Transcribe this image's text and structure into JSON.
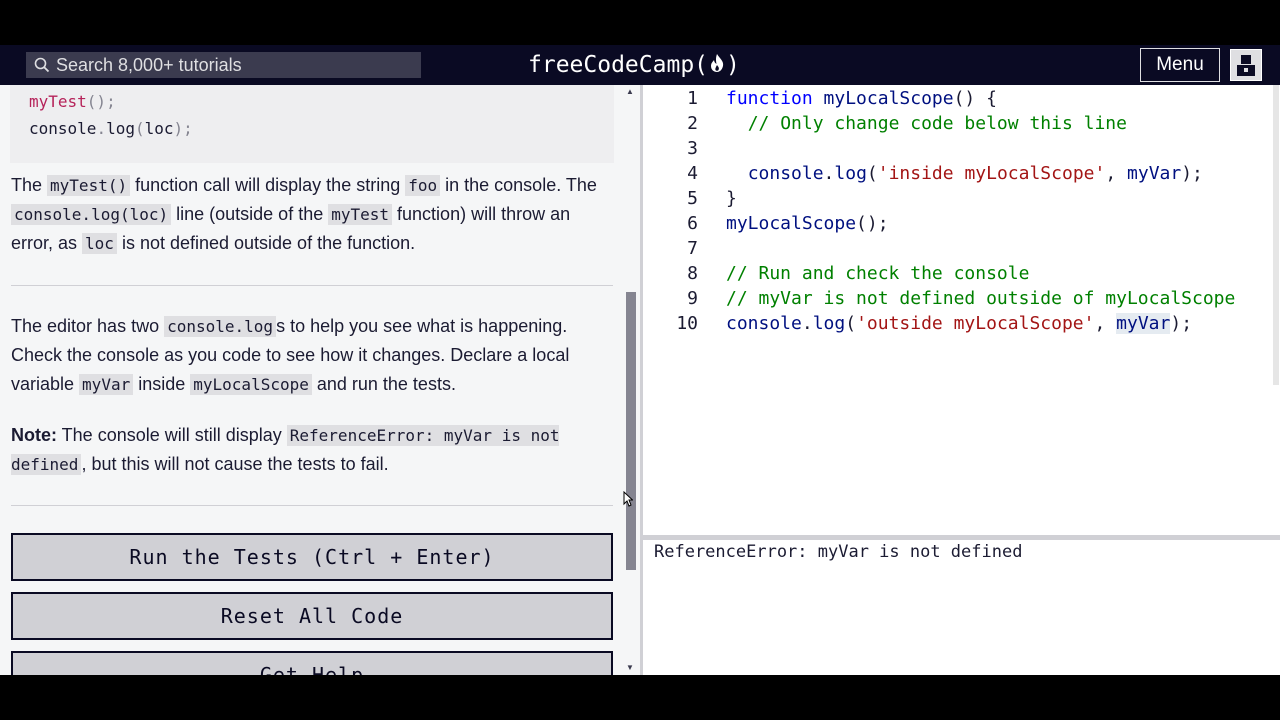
{
  "navbar": {
    "search_placeholder": "Search 8,000+ tutorials",
    "brand_text": "freeCodeCamp(",
    "brand_close": ")",
    "menu_label": "Menu",
    "icons": {
      "search": "search-icon",
      "flame": "flame-icon",
      "avatar": "avatar-icon"
    }
  },
  "instructions": {
    "code_example": {
      "line1": {
        "fn": "myTest",
        "punc": "();"
      },
      "line2": {
        "obj": "console",
        "dot": ".",
        "method": "log",
        "open": "(",
        "arg": "loc",
        "close": ");"
      }
    },
    "para1": {
      "t1": "The ",
      "c1": "myTest()",
      "t2": " function call will display the string ",
      "c2": "foo",
      "t3": " in the console. The ",
      "c3": "console.log(loc)",
      "t4": " line (outside of the ",
      "c4": "myTest",
      "t5": " function) will throw an error, as ",
      "c5": "loc",
      "t6": " is not defined outside of the function."
    },
    "para2": {
      "t1": "The editor has two ",
      "c1": "console.log",
      "t2": "s to help you see what is happening. Check the console as you code to see how it changes. Declare a local variable ",
      "c2": "myVar",
      "t3": " inside ",
      "c3": "myLocalScope",
      "t4": " and run the tests."
    },
    "para3": {
      "bold": "Note:",
      "t1": " The console will still display ",
      "c1": "ReferenceError: myVar is not defined",
      "t2": ", but this will not cause the tests to fail."
    }
  },
  "buttons": {
    "run": "Run the Tests (Ctrl + Enter)",
    "reset": "Reset All Code",
    "help": "Get Help"
  },
  "editor": {
    "lines": [
      {
        "num": "1",
        "parts": [
          [
            "kw",
            "function"
          ],
          [
            "plain",
            " "
          ],
          [
            "id",
            "myLocalScope"
          ],
          [
            "plain",
            "() {"
          ]
        ]
      },
      {
        "num": "2",
        "parts": [
          [
            "plain",
            "  "
          ],
          [
            "cm",
            "// Only change code below this line"
          ]
        ]
      },
      {
        "num": "3",
        "parts": []
      },
      {
        "num": "4",
        "parts": [
          [
            "plain",
            "  "
          ],
          [
            "id",
            "console"
          ],
          [
            "plain",
            "."
          ],
          [
            "id",
            "log"
          ],
          [
            "plain",
            "("
          ],
          [
            "st",
            "'inside myLocalScope'"
          ],
          [
            "plain",
            ", "
          ],
          [
            "id",
            "myVar"
          ],
          [
            "plain",
            ");"
          ]
        ]
      },
      {
        "num": "5",
        "parts": [
          [
            "plain",
            "}"
          ]
        ]
      },
      {
        "num": "6",
        "parts": [
          [
            "id",
            "myLocalScope"
          ],
          [
            "plain",
            "();"
          ]
        ]
      },
      {
        "num": "7",
        "parts": []
      },
      {
        "num": "8",
        "parts": [
          [
            "cm",
            "// Run and check the console"
          ]
        ]
      },
      {
        "num": "9",
        "parts": [
          [
            "cm",
            "// myVar is not defined outside of myLocalScope"
          ]
        ]
      },
      {
        "num": "10",
        "parts": [
          [
            "id",
            "console"
          ],
          [
            "plain",
            "."
          ],
          [
            "id",
            "log"
          ],
          [
            "plain",
            "("
          ],
          [
            "st",
            "'outside myLocalScope'"
          ],
          [
            "plain",
            ", "
          ],
          [
            "id hl",
            "myVar"
          ],
          [
            "plain",
            ");"
          ]
        ]
      }
    ]
  },
  "console": {
    "output": "ReferenceError: myVar is not defined"
  },
  "colors": {
    "navbar_bg": "#0a0a23",
    "pane_bg": "#f5f6f7",
    "keyword": "#0000ff",
    "comment": "#008000",
    "string": "#a31515"
  }
}
